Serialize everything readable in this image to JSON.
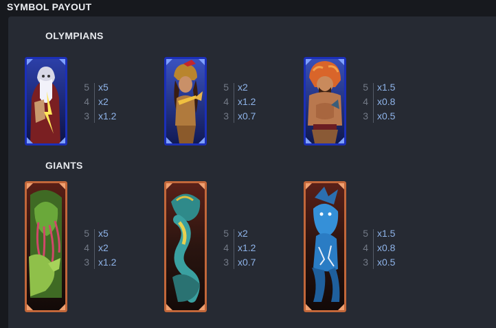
{
  "header": {
    "title": "SYMBOL PAYOUT"
  },
  "sections": [
    {
      "title": "OLYMPIANS",
      "symbols": [
        {
          "icon": "zeus-card-icon",
          "rows": [
            {
              "count": "5",
              "mult": "x5"
            },
            {
              "count": "4",
              "mult": "x2"
            },
            {
              "count": "3",
              "mult": "x1.2"
            }
          ]
        },
        {
          "icon": "athena-card-icon",
          "rows": [
            {
              "count": "5",
              "mult": "x2"
            },
            {
              "count": "4",
              "mult": "x1.2"
            },
            {
              "count": "3",
              "mult": "x0.7"
            }
          ]
        },
        {
          "icon": "hercules-card-icon",
          "rows": [
            {
              "count": "5",
              "mult": "x1.5"
            },
            {
              "count": "4",
              "mult": "x0.8"
            },
            {
              "count": "3",
              "mult": "x0.5"
            }
          ]
        }
      ]
    },
    {
      "title": "GIANTS",
      "symbols": [
        {
          "icon": "tentacle-monster-card-icon",
          "rows": [
            {
              "count": "5",
              "mult": "x5"
            },
            {
              "count": "4",
              "mult": "x2"
            },
            {
              "count": "3",
              "mult": "x1.2"
            }
          ]
        },
        {
          "icon": "serpent-card-icon",
          "rows": [
            {
              "count": "5",
              "mult": "x2"
            },
            {
              "count": "4",
              "mult": "x1.2"
            },
            {
              "count": "3",
              "mult": "x0.7"
            }
          ]
        },
        {
          "icon": "blue-giant-card-icon",
          "rows": [
            {
              "count": "5",
              "mult": "x1.5"
            },
            {
              "count": "4",
              "mult": "x0.8"
            },
            {
              "count": "3",
              "mult": "x0.5"
            }
          ]
        }
      ]
    }
  ],
  "colors": {
    "olympian_frame": "#2f4fd6",
    "giant_frame": "#c2673a",
    "multiplier": "#8fb4ea",
    "count": "#737a87"
  }
}
